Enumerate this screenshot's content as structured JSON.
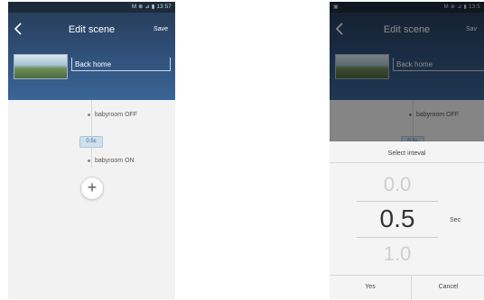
{
  "status_bar": {
    "left_icon": "notification-icon",
    "indicators": "M ⊕ ⊿ ▮",
    "time": "13:57",
    "time_partial": "13:5"
  },
  "header": {
    "title": "Edit scene",
    "save_label": "Save",
    "save_label_partial": "Sav",
    "scene_name": "Back home"
  },
  "scene": {
    "actions": [
      "babyroom OFF",
      "babyroom ON"
    ],
    "interval": "0.5s",
    "interval_partial": "0.5s",
    "add_label": "+"
  },
  "dialog": {
    "title": "Select inteval",
    "values": [
      "0.0",
      "0.5",
      "1.0"
    ],
    "unit": "Sec",
    "yes_label": "Yes",
    "cancel_label": "Cancel"
  },
  "colors": {
    "header_top": "#283e5c",
    "header_bottom": "#3a6597",
    "interval_badge": "#cfe0ee",
    "background": "#f2f2f2"
  }
}
